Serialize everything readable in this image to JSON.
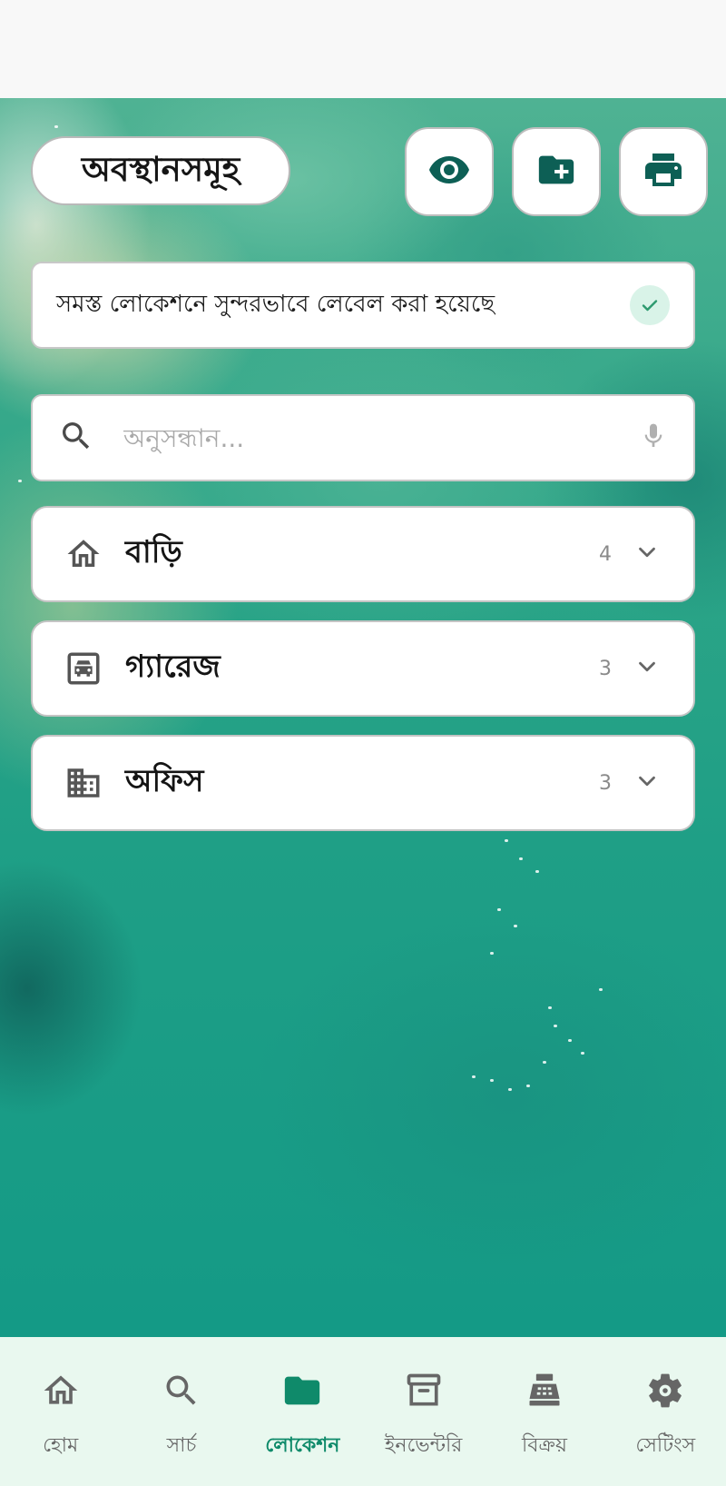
{
  "header": {
    "title": "অবস্থানসমূহ",
    "actions": [
      {
        "name": "visibility",
        "icon": "eye-icon"
      },
      {
        "name": "add-folder",
        "icon": "folder-plus-icon"
      },
      {
        "name": "print",
        "icon": "printer-icon"
      }
    ]
  },
  "banner": {
    "text": "সমস্ত লোকেশনে সুন্দরভাবে লেবেল করা হয়েছে",
    "icon": "check-icon"
  },
  "search": {
    "placeholder": "অনুসন্ধান...",
    "value": "",
    "icons": [
      "search-icon",
      "mic-icon"
    ]
  },
  "locations": [
    {
      "name": "বাড়ি",
      "count": "4",
      "icon": "home-outline-icon"
    },
    {
      "name": "গ্যারেজ",
      "count": "3",
      "icon": "garage-car-icon"
    },
    {
      "name": "অফিস",
      "count": "3",
      "icon": "office-building-icon"
    }
  ],
  "nav": {
    "active": "লোকেশন",
    "items": [
      {
        "label": "হোম",
        "icon": "home-icon"
      },
      {
        "label": "সার্চ",
        "icon": "search-icon"
      },
      {
        "label": "লোকেশন",
        "icon": "folder-icon"
      },
      {
        "label": "ইনভেন্টরি",
        "icon": "archive-icon"
      },
      {
        "label": "বিক্রয়",
        "icon": "cash-register-icon"
      },
      {
        "label": "সেটিংস",
        "icon": "gear-icon"
      }
    ]
  },
  "colors": {
    "accent": "#0f8a6a",
    "icon_dark": "#0d5f55",
    "nav_background": "#e9f8ef"
  }
}
